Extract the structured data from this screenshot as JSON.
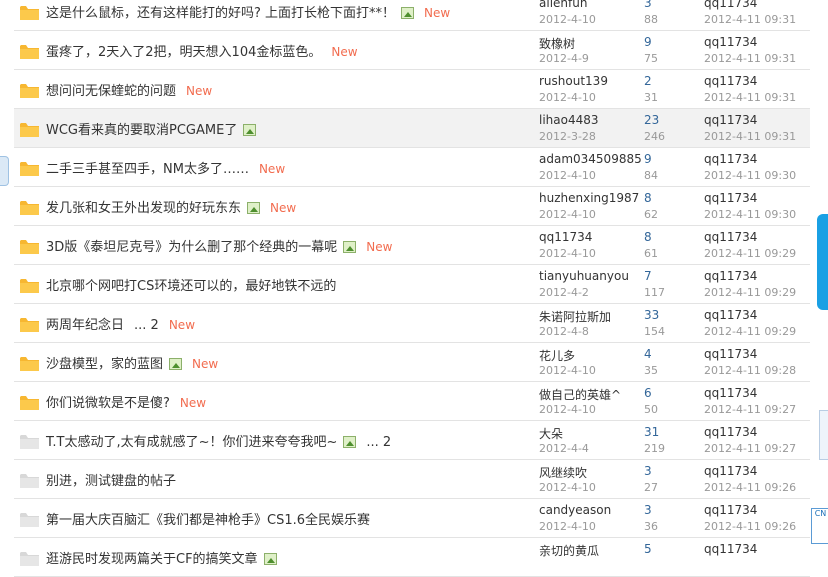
{
  "threads": [
    {
      "title": "这是什么鼠标，还有这样能打的好吗? 上面打长枪下面打**！",
      "img": true,
      "pages": "",
      "new": "New",
      "author": "allenfun",
      "date": "2012-4-10",
      "replies": "3",
      "views": "88",
      "last_user": "qq11734",
      "last_time": "2012-4-11 09:31",
      "hot": true
    },
    {
      "title": "蛋疼了，2天入了2把，明天想入104金标蓝色。",
      "img": false,
      "pages": "",
      "new": "New",
      "author": "致橡树",
      "date": "2012-4-9",
      "replies": "9",
      "views": "75",
      "last_user": "qq11734",
      "last_time": "2012-4-11 09:31",
      "hot": true
    },
    {
      "title": "想问问无保蝰蛇的问题",
      "img": false,
      "pages": "",
      "new": "New",
      "author": "rushout139",
      "date": "2012-4-10",
      "replies": "2",
      "views": "31",
      "last_user": "qq11734",
      "last_time": "2012-4-11 09:31",
      "hot": true
    },
    {
      "title": "WCG看来真的要取消PCGAME了",
      "img": true,
      "pages": "",
      "new": "",
      "author": "lihao4483",
      "date": "2012-3-28",
      "replies": "23",
      "views": "246",
      "last_user": "qq11734",
      "last_time": "2012-4-11 09:31",
      "hot": true
    },
    {
      "title": "二手三手甚至四手，NM太多了……",
      "img": false,
      "pages": "",
      "new": "New",
      "author": "adam034509885",
      "date": "2012-4-10",
      "replies": "9",
      "views": "84",
      "last_user": "qq11734",
      "last_time": "2012-4-11 09:30",
      "hot": true
    },
    {
      "title": "发几张和女王外出发现的好玩东东",
      "img": true,
      "pages": "",
      "new": "New",
      "author": "huzhenxing1987",
      "date": "2012-4-10",
      "replies": "8",
      "views": "62",
      "last_user": "qq11734",
      "last_time": "2012-4-11 09:30",
      "hot": true
    },
    {
      "title": "3D版《泰坦尼克号》为什么删了那个经典的一幕呢",
      "img": true,
      "pages": "",
      "new": "New",
      "author": "qq11734",
      "date": "2012-4-10",
      "replies": "8",
      "views": "61",
      "last_user": "qq11734",
      "last_time": "2012-4-11 09:29",
      "hot": true
    },
    {
      "title": "北京哪个网吧打CS环境还可以的，最好地铁不远的",
      "img": false,
      "pages": "",
      "new": "",
      "author": "tianyuhuanyou",
      "date": "2012-4-2",
      "replies": "7",
      "views": "117",
      "last_user": "qq11734",
      "last_time": "2012-4-11 09:29",
      "hot": true
    },
    {
      "title": "两周年纪念日",
      "img": false,
      "pages": "... 2",
      "new": "New",
      "author": "朱诺阿拉斯加",
      "date": "2012-4-8",
      "replies": "33",
      "views": "154",
      "last_user": "qq11734",
      "last_time": "2012-4-11 09:29",
      "hot": true
    },
    {
      "title": "沙盘模型，家的蓝图",
      "img": true,
      "pages": "",
      "new": "New",
      "author": "花儿多",
      "date": "2012-4-10",
      "replies": "4",
      "views": "35",
      "last_user": "qq11734",
      "last_time": "2012-4-11 09:28",
      "hot": true
    },
    {
      "title": "你们说微软是不是傻?",
      "img": false,
      "pages": "",
      "new": "New",
      "author": "做自己的英雄^",
      "date": "2012-4-10",
      "replies": "6",
      "views": "50",
      "last_user": "qq11734",
      "last_time": "2012-4-11 09:27",
      "hot": true
    },
    {
      "title": "T.T太感动了,太有成就感了~！你们进来夸夸我吧~",
      "img": true,
      "pages": "... 2",
      "new": "",
      "author": "大朵",
      "date": "2012-4-4",
      "replies": "31",
      "views": "219",
      "last_user": "qq11734",
      "last_time": "2012-4-11 09:27",
      "hot": false
    },
    {
      "title": "别进，测试键盘的帖子",
      "img": false,
      "pages": "",
      "new": "",
      "author": "风继续吹",
      "date": "2012-4-10",
      "replies": "3",
      "views": "27",
      "last_user": "qq11734",
      "last_time": "2012-4-11 09:26",
      "hot": false
    },
    {
      "title": "第一届大庆百脑汇《我们都是神枪手》CS1.6全民娱乐赛",
      "img": false,
      "pages": "",
      "new": "",
      "author": "candyeason",
      "date": "2012-4-10",
      "replies": "3",
      "views": "36",
      "last_user": "qq11734",
      "last_time": "2012-4-11 09:26",
      "hot": false
    },
    {
      "title": "逛游民时发现两篇关于CF的搞笑文章",
      "img": true,
      "pages": "",
      "new": "",
      "author": "亲切的黄瓜",
      "date": "",
      "replies": "5",
      "views": "",
      "last_user": "qq11734",
      "last_time": "",
      "hot": false
    }
  ],
  "highlight_row": 3,
  "colors": {
    "folder_hot": "#f7b731",
    "folder_normal": "#d8d8d8",
    "new": "#f26c4f",
    "replies": "#336699"
  },
  "side": {
    "logo_text": "CN"
  }
}
